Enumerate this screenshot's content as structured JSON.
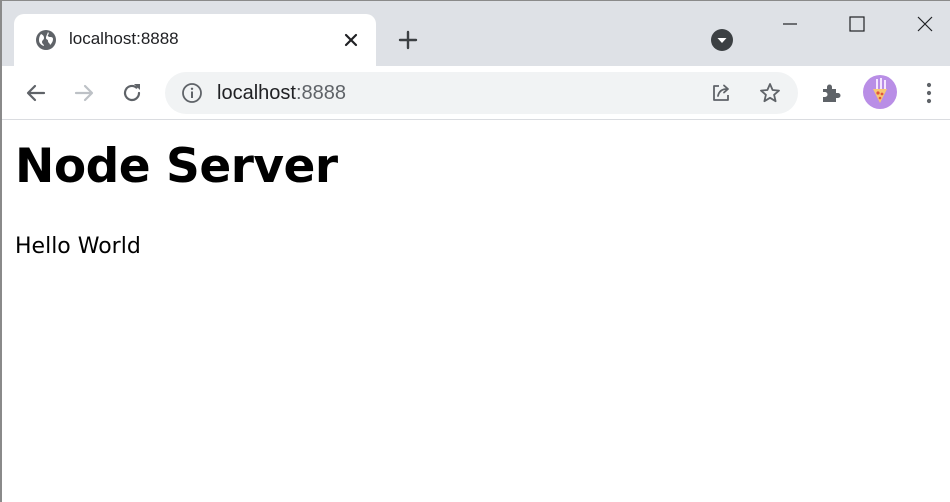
{
  "tab": {
    "title": "localhost:8888"
  },
  "address_bar": {
    "host": "localhost",
    "port": ":8888"
  },
  "page": {
    "heading": "Node Server",
    "paragraph": "Hello World"
  },
  "colors": {
    "tabstrip_bg": "#dee1e6",
    "omnibox_bg": "#f1f3f4",
    "icon_gray": "#5f6368",
    "profile_purple": "#b98ee6"
  }
}
